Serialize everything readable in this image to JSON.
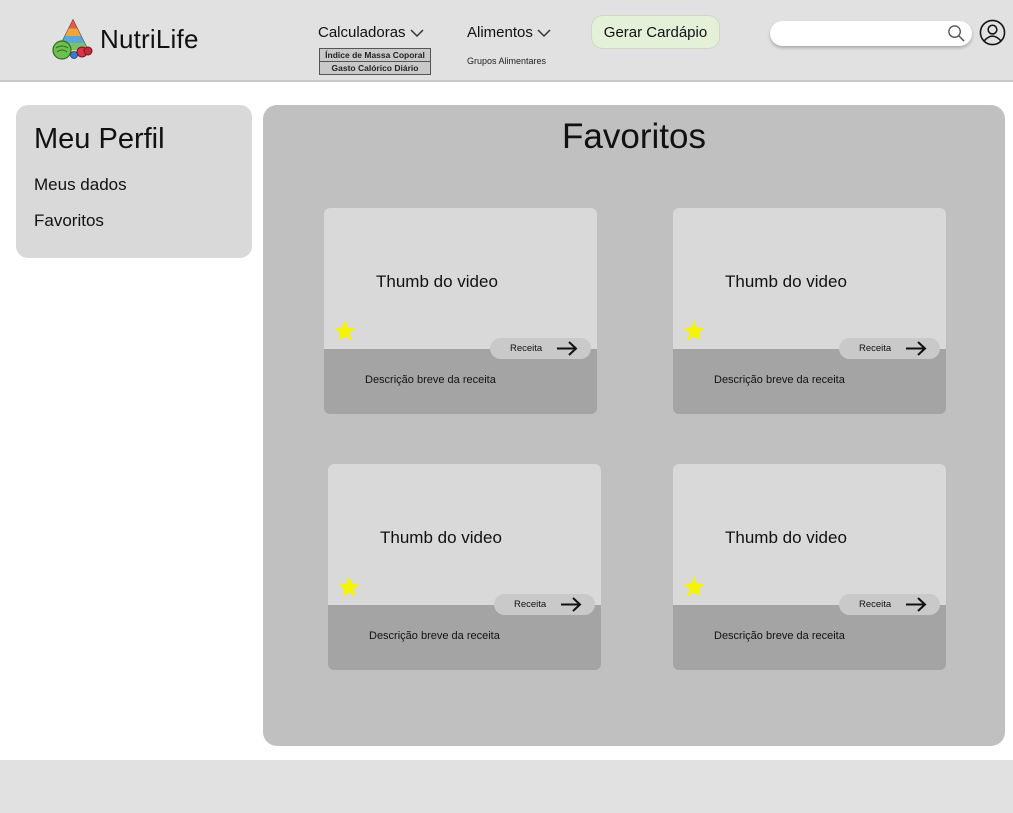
{
  "header": {
    "brand": "NutriLife",
    "nav": {
      "calculadoras": "Calculadoras",
      "calculadoras_items": [
        "Índice de Massa Coporal",
        "Gasto Calórico Diário"
      ],
      "alimentos": "Alimentos",
      "alimentos_items": [
        "Grupos Alimentares"
      ]
    },
    "gerar_cardapio": "Gerar Cardápio",
    "search": {
      "value": "",
      "placeholder": ""
    }
  },
  "sidebar": {
    "title": "Meu Perfil",
    "items": [
      "Meus dados",
      "Favoritos"
    ]
  },
  "main": {
    "title": "Favoritos",
    "cards": [
      {
        "thumb": "Thumb do video",
        "button": "Receita",
        "description": "Descrição breve da receita",
        "favorited": true
      },
      {
        "thumb": "Thumb do video",
        "button": "Receita",
        "description": "Descrição breve da receita",
        "favorited": true
      },
      {
        "thumb": "Thumb do video",
        "button": "Receita",
        "description": "Descrição breve da receita",
        "favorited": true
      },
      {
        "thumb": "Thumb do video",
        "button": "Receita",
        "description": "Descrição breve da receita",
        "favorited": true
      }
    ]
  },
  "icons": {
    "logo": "food-pyramid-icon",
    "search": "search-icon",
    "profile": "user-circle-icon",
    "favorite": "star-icon",
    "arrow": "arrow-right-icon",
    "dropdown": "chevron-down-icon"
  },
  "colors": {
    "header_bg": "#e1e1e1",
    "button_green": "#e4f0d8",
    "panel_bg": "#c0c0c0",
    "card_thumb": "#d9d9d9",
    "card_footer": "#a4a4a4",
    "star": "#f5f500"
  }
}
